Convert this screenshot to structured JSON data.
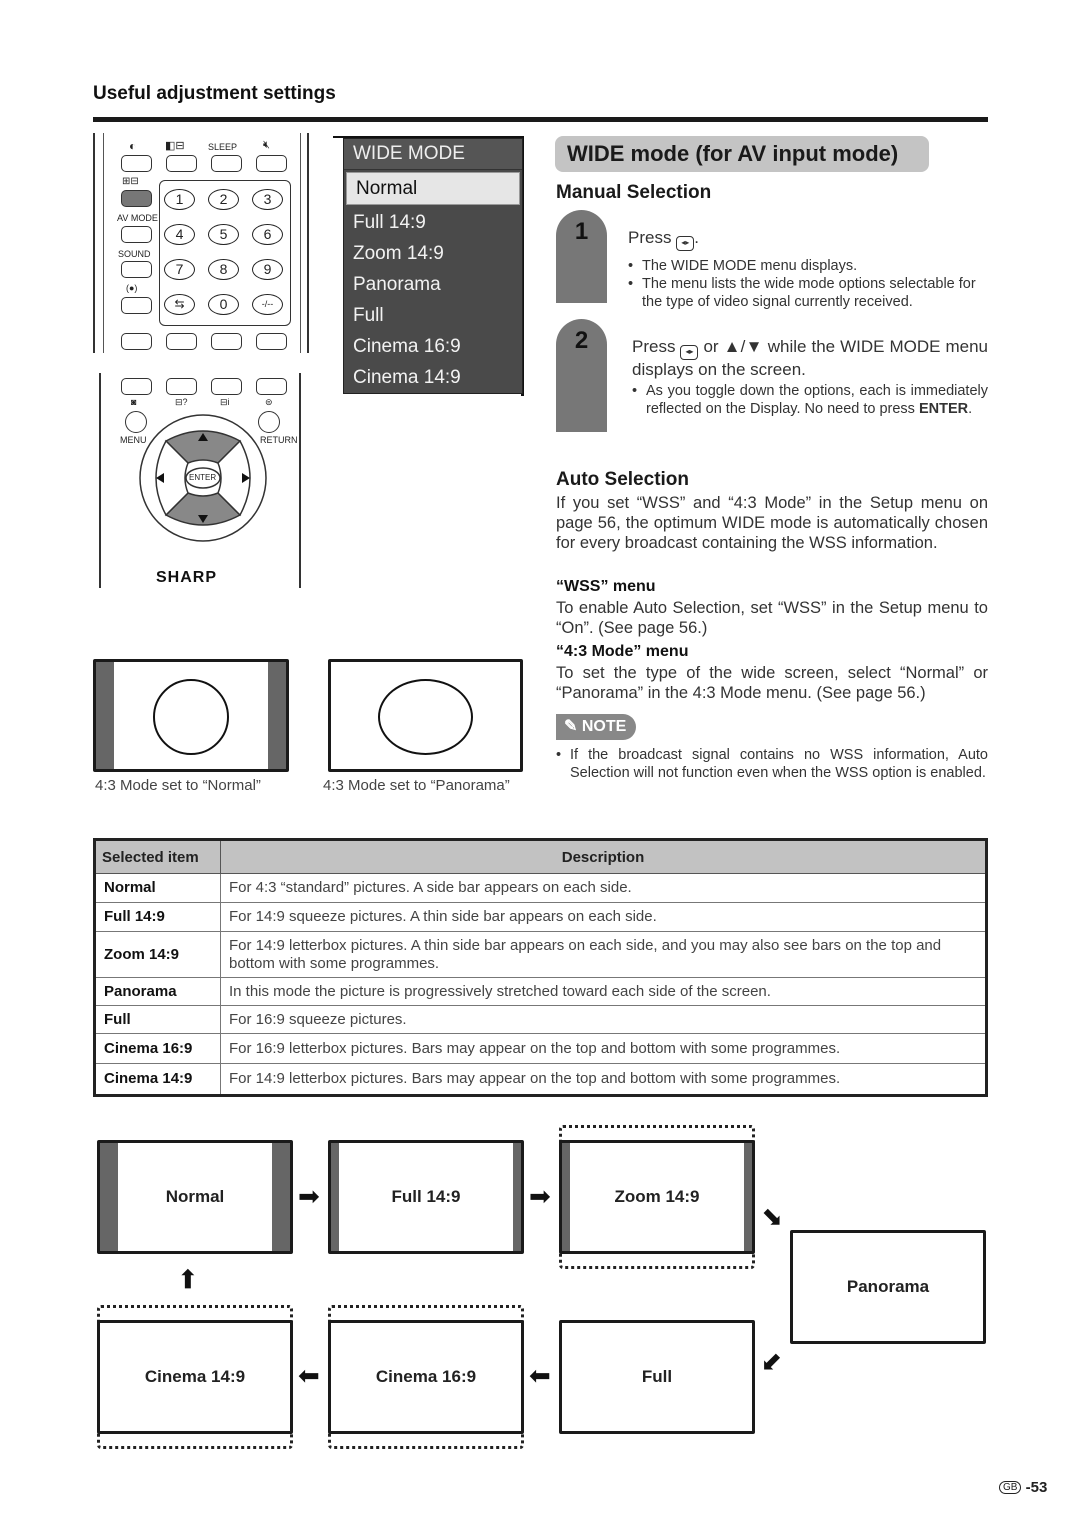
{
  "header": {
    "section_title": "Useful adjustment settings"
  },
  "remote": {
    "top_labels": [
      "SLEEP"
    ],
    "side_labels": [
      "AV MODE",
      "SOUND",
      "(●)"
    ],
    "numbers": [
      "1",
      "2",
      "3",
      "4",
      "5",
      "6",
      "7",
      "8",
      "9",
      "⇆",
      "0",
      "-/--"
    ],
    "menu_label": "MENU",
    "return_label": "RETURN",
    "enter_label": "ENTER",
    "brand": "SHARP"
  },
  "wide_menu": {
    "title": "WIDE MODE",
    "items": [
      "Normal",
      "Full 14:9",
      "Zoom 14:9",
      "Panorama",
      "Full",
      "Cinema 16:9",
      "Cinema 14:9"
    ],
    "selected": "Normal"
  },
  "main": {
    "banner": "WIDE mode (for AV input mode)",
    "manual_heading": "Manual Selection",
    "step1": {
      "number": "1",
      "press_prefix": "Press",
      "press_suffix": ".",
      "bullets": [
        "The WIDE MODE menu displays.",
        "The menu lists the wide mode options selectable for the type of video signal currently received."
      ]
    },
    "step2": {
      "number": "2",
      "press_prefix": "Press",
      "press_mid": "or",
      "press_arrows": "▲/▼",
      "press_suffix": "while the WIDE MODE menu displays on the screen.",
      "bullet_text": "As you toggle down the options, each is immediately reflected on the Display. No need to press",
      "bullet_bold": "ENTER",
      "bullet_end": "."
    },
    "auto_heading": "Auto Selection",
    "auto_text": "If you set “WSS” and “4:3 Mode” in the Setup menu on page 56, the optimum WIDE mode is automatically chosen for every broadcast containing the WSS information.",
    "wss_heading": "“WSS” menu",
    "wss_text": "To enable Auto Selection, set “WSS” in the Setup menu to “On”. (See page 56.)",
    "mode43_heading": "“4:3 Mode” menu",
    "mode43_text": "To set the type of the wide screen, select “Normal” or “Panorama” in the 4:3 Mode menu. (See page 56.)",
    "note_label": "NOTE",
    "note_text": "If the broadcast signal contains no WSS information, Auto Selection will not function even when the WSS option is enabled."
  },
  "illustrations": {
    "normal_caption": "4:3 Mode set to “Normal”",
    "panorama_caption": "4:3 Mode set to “Panorama”"
  },
  "table": {
    "headers": [
      "Selected item",
      "Description"
    ],
    "rows": [
      {
        "item": "Normal",
        "desc": "For 4:3 “standard” pictures. A side bar appears on each side."
      },
      {
        "item": "Full 14:9",
        "desc": "For 14:9 squeeze pictures. A thin side bar appears on each side."
      },
      {
        "item": "Zoom 14:9",
        "desc": "For 14:9 letterbox pictures. A thin side bar appears on each side, and you may also see bars on the top and bottom with some programmes."
      },
      {
        "item": "Panorama",
        "desc": "In this mode the picture is progressively stretched toward each side of the screen."
      },
      {
        "item": "Full",
        "desc": "For 16:9 squeeze pictures."
      },
      {
        "item": "Cinema 16:9",
        "desc": "For 16:9 letterbox pictures. Bars may appear on the top and bottom with some programmes."
      },
      {
        "item": "Cinema 14:9",
        "desc": "For 14:9 letterbox pictures. Bars may appear on the top and bottom with some programmes."
      }
    ]
  },
  "flow": {
    "boxes": [
      "Normal",
      "Full 14:9",
      "Zoom 14:9",
      "Panorama",
      "Full",
      "Cinema 16:9",
      "Cinema 14:9"
    ]
  },
  "footer": {
    "region": "GB",
    "page": "-53"
  }
}
